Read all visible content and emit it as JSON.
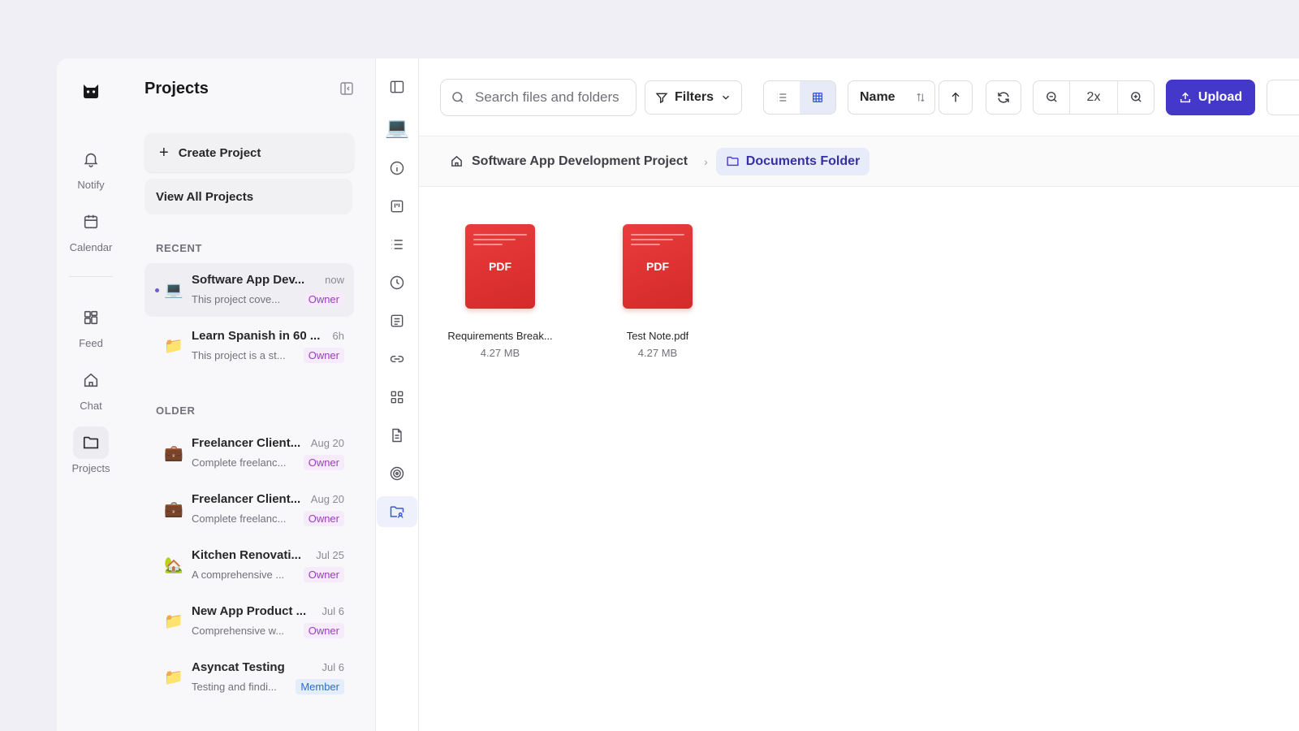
{
  "rail": {
    "items": [
      {
        "label": "Notify",
        "icon": "bell-icon"
      },
      {
        "label": "Calendar",
        "icon": "calendar-icon"
      },
      {
        "label": "Feed",
        "icon": "feed-icon"
      },
      {
        "label": "Chat",
        "icon": "home-icon"
      },
      {
        "label": "Projects",
        "icon": "folder-icon"
      }
    ]
  },
  "panel": {
    "title": "Projects",
    "create_label": "Create Project",
    "view_all_label": "View All Projects",
    "recent_label": "RECENT",
    "older_label": "OLDER",
    "recent": [
      {
        "emoji": "💻",
        "name": "Software App Dev...",
        "time": "now",
        "desc": "This project cove...",
        "role": "Owner"
      },
      {
        "emoji": "📁",
        "name": "Learn Spanish in 60 ...",
        "time": "6h",
        "desc": "This project is a st...",
        "role": "Owner"
      }
    ],
    "older": [
      {
        "emoji": "💼",
        "name": "Freelancer Client...",
        "time": "Aug 20",
        "desc": "Complete freelanc...",
        "role": "Owner"
      },
      {
        "emoji": "💼",
        "name": "Freelancer Client...",
        "time": "Aug 20",
        "desc": "Complete freelanc...",
        "role": "Owner"
      },
      {
        "emoji": "🏡",
        "name": "Kitchen Renovati...",
        "time": "Jul 25",
        "desc": "A comprehensive ...",
        "role": "Owner"
      },
      {
        "emoji": "📁",
        "name": "New App Product ...",
        "time": "Jul 6",
        "desc": "Comprehensive w...",
        "role": "Owner"
      },
      {
        "emoji": "📁",
        "name": "Asyncat Testing",
        "time": "Jul 6",
        "desc": "Testing and findi...",
        "role": "Member"
      }
    ]
  },
  "toolbar": {
    "search_placeholder": "Search files and folders",
    "filters_label": "Filters",
    "sort_label": "Name",
    "zoom_level": "2x",
    "upload_label": "Upload"
  },
  "breadcrumb": {
    "root": "Software App Development Project",
    "current": "Documents Folder"
  },
  "files": [
    {
      "name": "Requirements Break...",
      "size": "4.27 MB",
      "type": "PDF"
    },
    {
      "name": "Test Note.pdf",
      "size": "4.27 MB",
      "type": "PDF"
    }
  ],
  "colors": {
    "accent": "#4338ca",
    "pdf": "#e03131",
    "owner_badge": "#9d3bc0",
    "member_badge": "#2d6bd1"
  }
}
